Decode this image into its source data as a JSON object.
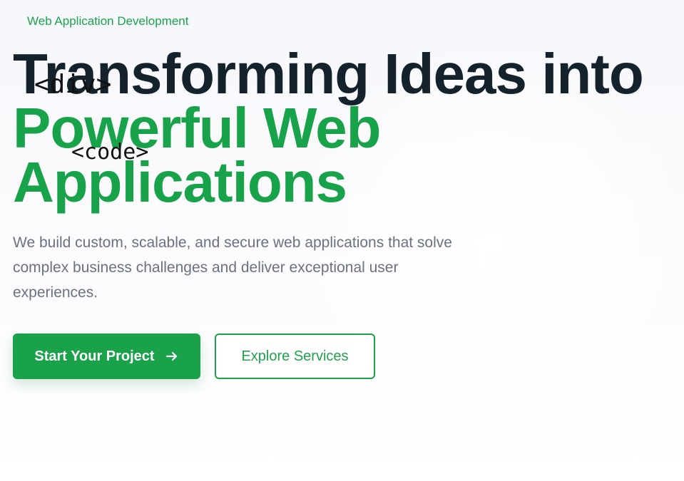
{
  "hero": {
    "eyebrow": "Web Application Development",
    "headline_line1": "Transforming Ideas into",
    "headline_accent_line2": "Powerful Web",
    "headline_accent_line3": "Applications",
    "overlay_div_text": "<div>",
    "overlay_code_text": "<code>",
    "subtitle": "We build custom, scalable, and secure web applications that solve complex business challenges and deliver exceptional user experiences.",
    "primary_button": {
      "label": "Start Your Project",
      "icon": "arrow-right-icon"
    },
    "secondary_button": {
      "label": "Explore Services"
    }
  },
  "colors": {
    "brand_green": "#19a24a",
    "headline_dark": "#14232b",
    "body_gray": "#6b7180"
  }
}
